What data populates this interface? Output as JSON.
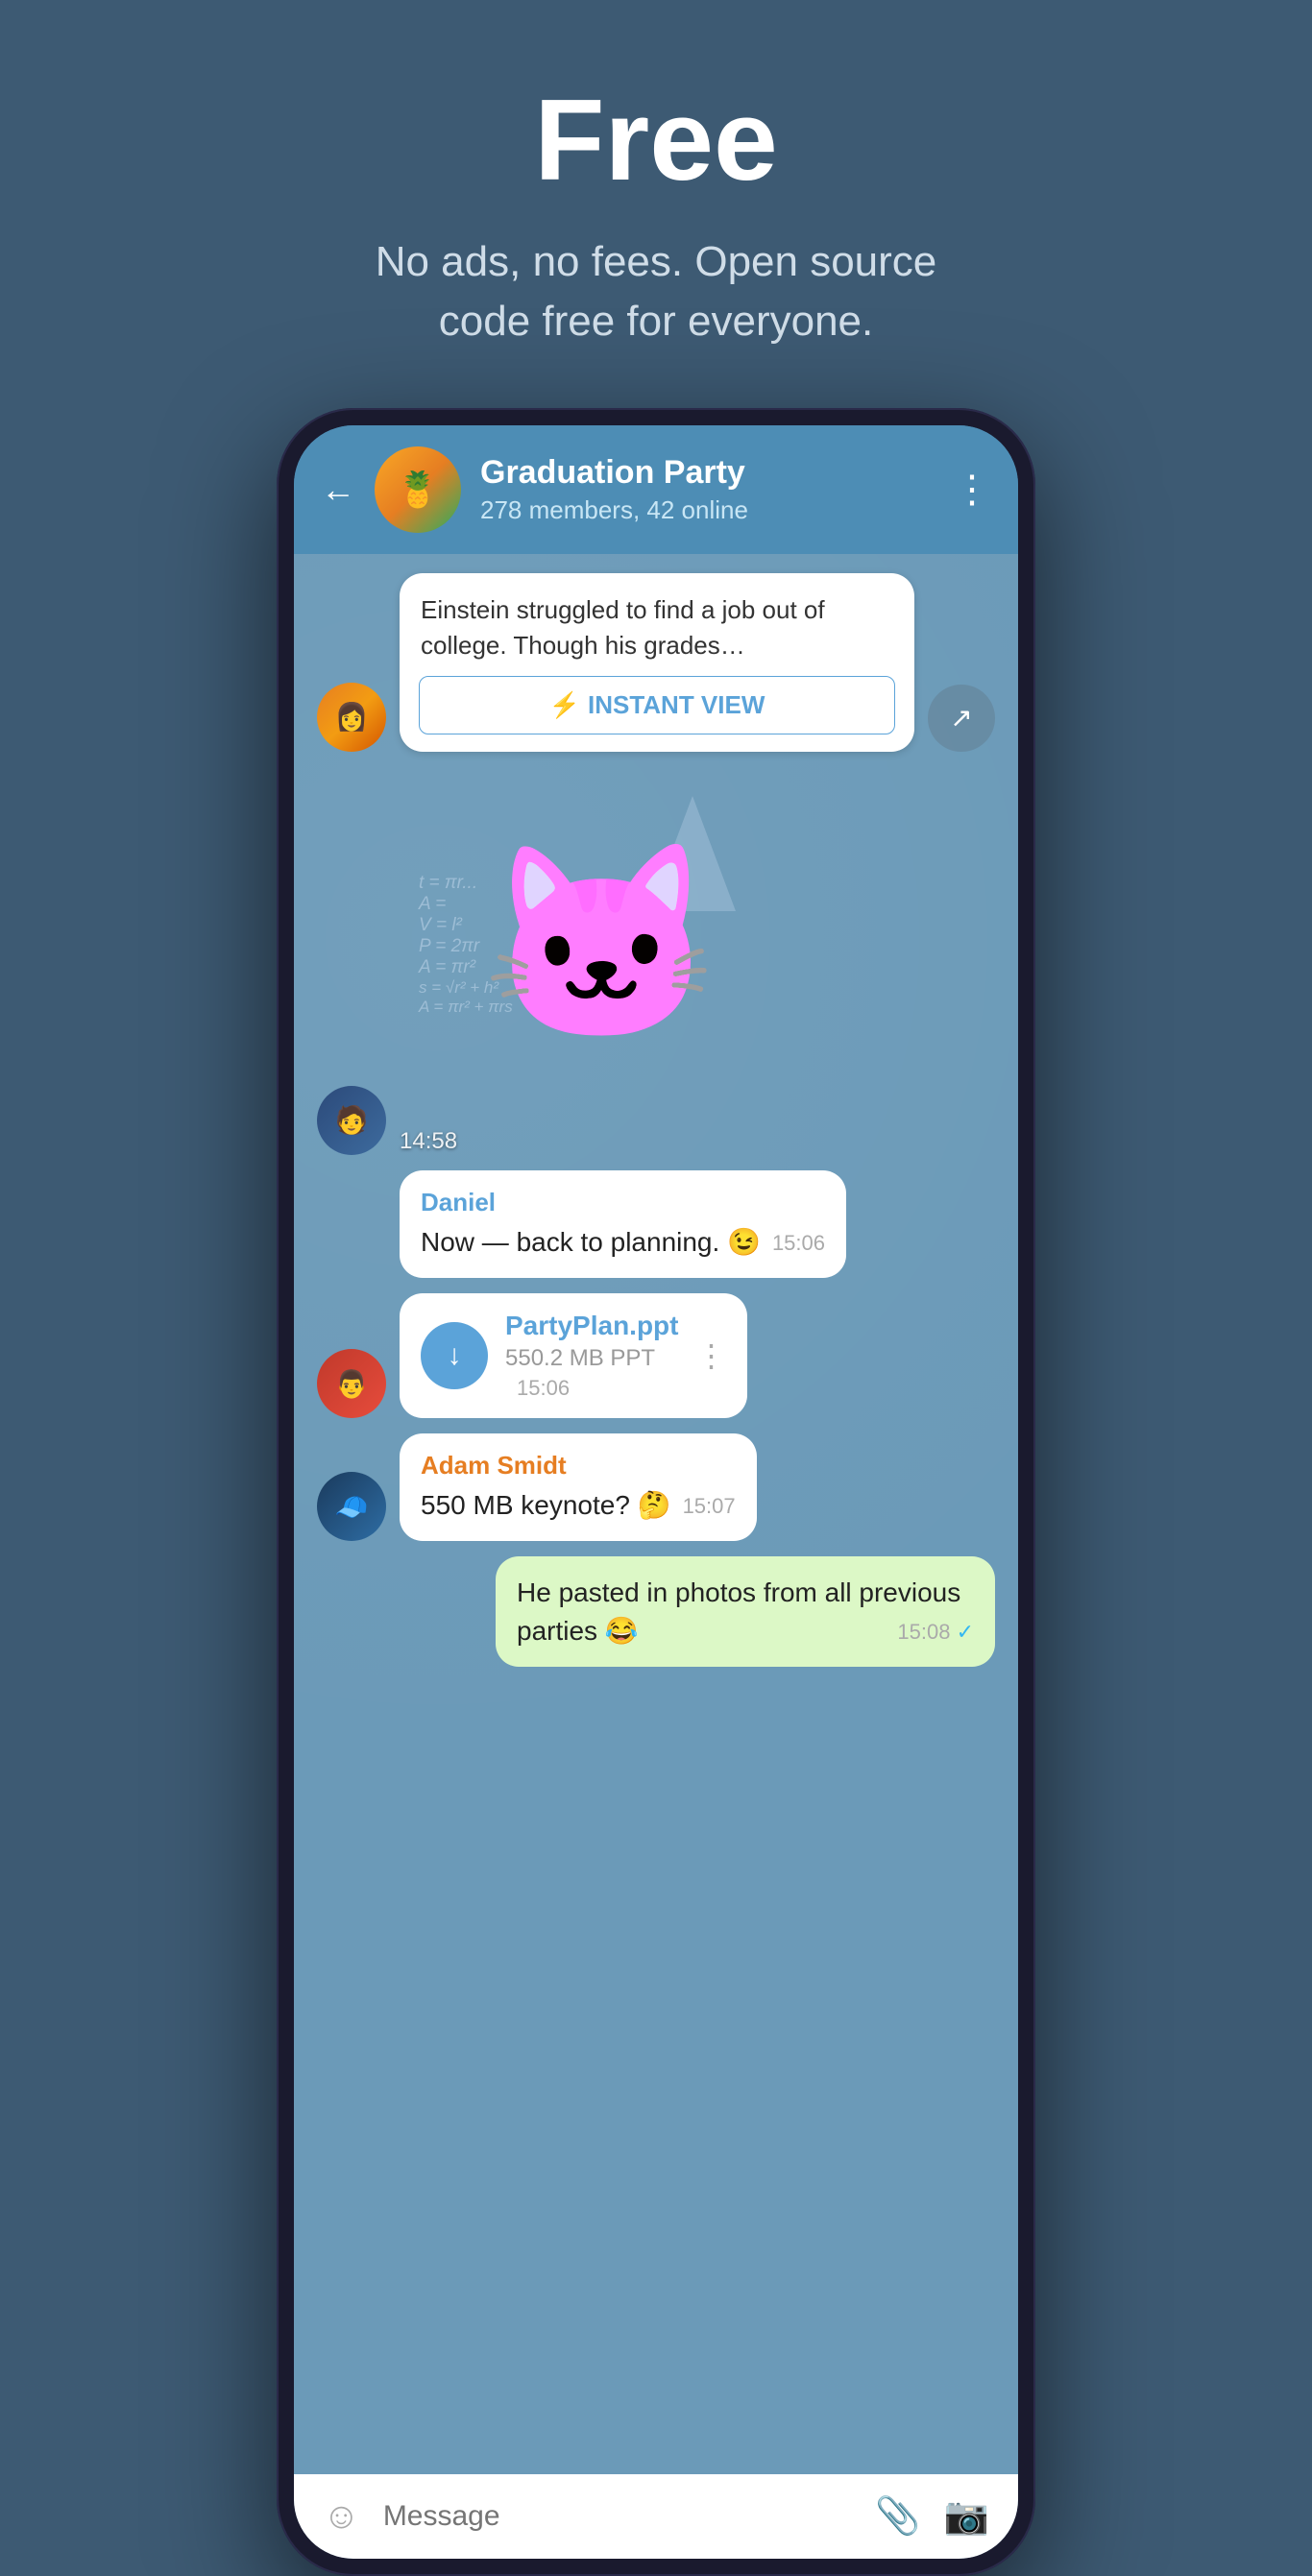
{
  "hero": {
    "title": "Free",
    "subtitle": "No ads, no fees. Open source\ncode free for everyone."
  },
  "phone": {
    "header": {
      "back_label": "←",
      "group_name": "Graduation Party",
      "group_meta": "278 members, 42 online",
      "more_label": "⋮"
    },
    "messages": [
      {
        "id": "article-msg",
        "type": "article",
        "avatar": "girl",
        "article_text": "Einstein struggled to find a job out of college. Though his grades...",
        "instant_view_label": "INSTANT VIEW"
      },
      {
        "id": "sticker-msg",
        "type": "sticker",
        "avatar": "boy",
        "time": "14:58"
      },
      {
        "id": "daniel-msg",
        "type": "text",
        "avatar": "none",
        "sender": "Daniel",
        "text": "Now — back to planning. 😉",
        "time": "15:06"
      },
      {
        "id": "file-msg",
        "type": "file",
        "avatar": "man",
        "file_name": "PartyPlan.ppt",
        "file_size": "550.2 MB PPT",
        "time": "15:06"
      },
      {
        "id": "adam-msg",
        "type": "text",
        "avatar": "hat",
        "sender": "Adam Smidt",
        "text": "550 MB keynote? 🤔",
        "time": "15:07"
      },
      {
        "id": "own-msg",
        "type": "own",
        "text": "He pasted in photos from all previous parties 😂",
        "time": "15:08"
      }
    ],
    "input_bar": {
      "placeholder": "Message",
      "emoji_icon": "☺",
      "attach_icon": "📎",
      "camera_icon": "📷"
    }
  }
}
